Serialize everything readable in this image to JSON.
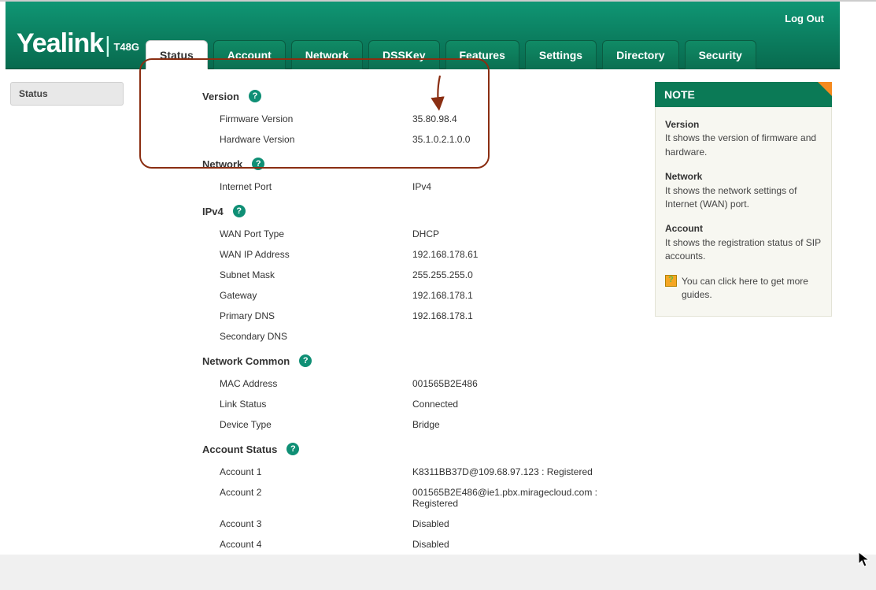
{
  "brand": {
    "name": "Yealink",
    "model": "T48G"
  },
  "logout": "Log Out",
  "tabs": [
    "Status",
    "Account",
    "Network",
    "DSSKey",
    "Features",
    "Settings",
    "Directory",
    "Security"
  ],
  "activeTab": "Status",
  "sidebar": {
    "items": [
      "Status"
    ]
  },
  "sections": {
    "version": {
      "title": "Version",
      "rows": [
        {
          "label": "Firmware Version",
          "value": "35.80.98.4"
        },
        {
          "label": "Hardware Version",
          "value": "35.1.0.2.1.0.0"
        }
      ]
    },
    "network": {
      "title": "Network",
      "rows": [
        {
          "label": "Internet Port",
          "value": "IPv4"
        }
      ]
    },
    "ipv4": {
      "title": "IPv4",
      "rows": [
        {
          "label": "WAN Port Type",
          "value": "DHCP"
        },
        {
          "label": "WAN IP Address",
          "value": "192.168.178.61"
        },
        {
          "label": "Subnet Mask",
          "value": "255.255.255.0"
        },
        {
          "label": "Gateway",
          "value": "192.168.178.1"
        },
        {
          "label": "Primary DNS",
          "value": "192.168.178.1"
        },
        {
          "label": "Secondary DNS",
          "value": ""
        }
      ]
    },
    "network_common": {
      "title": "Network Common",
      "rows": [
        {
          "label": "MAC Address",
          "value": "001565B2E486"
        },
        {
          "label": "Link Status",
          "value": "Connected"
        },
        {
          "label": "Device Type",
          "value": "Bridge"
        }
      ]
    },
    "account_status": {
      "title": "Account Status",
      "rows": [
        {
          "label": "Account 1",
          "value": "K8311BB37D@109.68.97.123 : Registered"
        },
        {
          "label": "Account 2",
          "value": "001565B2E486@ie1.pbx.miragecloud.com : Registered"
        },
        {
          "label": "Account 3",
          "value": "Disabled"
        },
        {
          "label": "Account 4",
          "value": "Disabled"
        }
      ]
    }
  },
  "note": {
    "title": "NOTE",
    "blocks": [
      {
        "h": "Version",
        "t": "It shows the version of firmware and hardware."
      },
      {
        "h": "Network",
        "t": "It shows the network settings of Internet (WAN) port."
      },
      {
        "h": "Account",
        "t": "It shows the registration status of SIP accounts."
      }
    ],
    "help": "You can click here to get more guides."
  }
}
